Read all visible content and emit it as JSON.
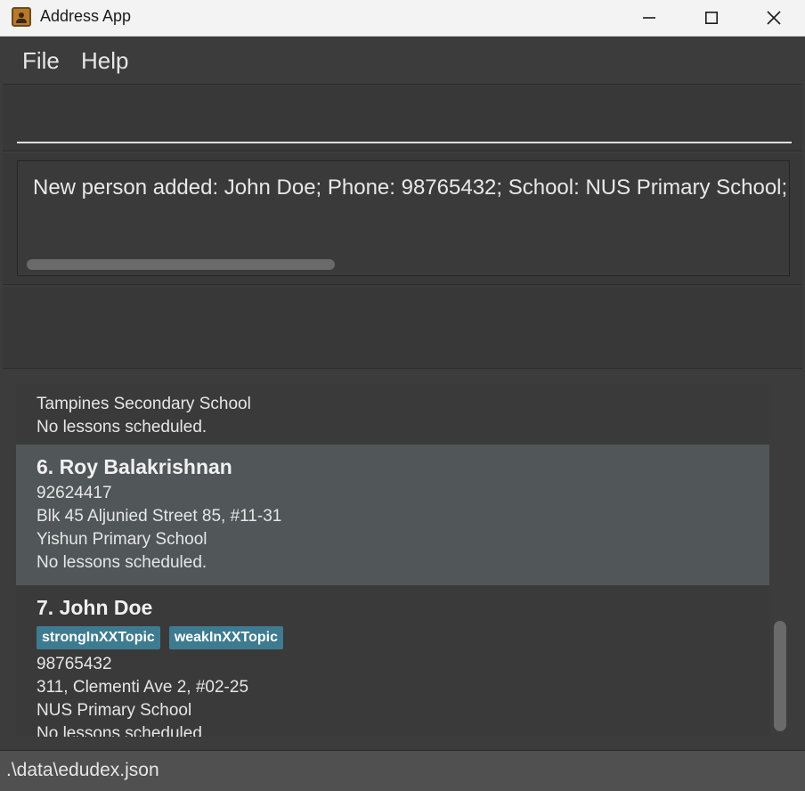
{
  "window": {
    "title": "Address App",
    "controls": [
      "minimize-icon",
      "maximize-icon",
      "close-icon"
    ]
  },
  "menu": {
    "file": "File",
    "help": "Help"
  },
  "command_box": {
    "value": "",
    "placeholder": ""
  },
  "result_display": {
    "text": "New person added: John Doe; Phone: 98765432; School: NUS Primary School;"
  },
  "person_list": {
    "partial_card": {
      "school": "Tampines Secondary School",
      "lessons": "No lessons scheduled."
    },
    "cards": [
      {
        "name": "6. Roy Balakrishnan",
        "tags": [],
        "phone": "92624417",
        "address": "Blk 45 Aljunied Street 85, #11-31",
        "school": "Yishun Primary School",
        "lessons": "No lessons scheduled.",
        "selected": true
      },
      {
        "name": "7. John Doe",
        "tags": [
          "strongInXXTopic",
          "weakInXXTopic"
        ],
        "phone": "98765432",
        "address": "311, Clementi Ave 2, #02-25",
        "school": "NUS Primary School",
        "lessons": "No lessons scheduled.",
        "selected": false
      }
    ]
  },
  "status_bar": {
    "path": ".\\data\\edudex.json"
  },
  "colors": {
    "background": "#3c3c3c",
    "selected_card": "#515658",
    "tag": "#3e7b91"
  }
}
